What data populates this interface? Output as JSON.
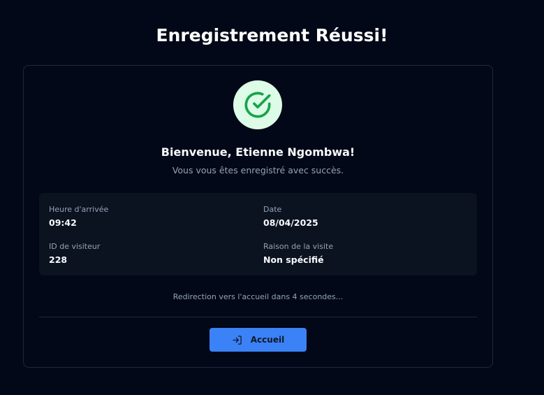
{
  "page": {
    "title": "Enregistrement Réussi!"
  },
  "card": {
    "welcome": "Bienvenue, Etienne Ngombwa!",
    "message": "Vous vous êtes enregistré avec succès.",
    "details": {
      "arrival_time": {
        "label": "Heure d'arrivée",
        "value": "09:42"
      },
      "date": {
        "label": "Date",
        "value": "08/04/2025"
      },
      "visitor_id": {
        "label": "ID de visiteur",
        "value": "228"
      },
      "visit_reason": {
        "label": "Raison de la visite",
        "value": "Non spécifié"
      }
    },
    "redirect_text": "Redirection vers l'accueil dans 4 secondes...",
    "home_button_label": "Accueil"
  },
  "colors": {
    "background": "#020817",
    "accent": "#3b82f6",
    "success": "#16a34a",
    "success_bg": "#dcfce7"
  },
  "icons": {
    "success": "check-circle-icon",
    "home_button": "log-in-icon"
  }
}
